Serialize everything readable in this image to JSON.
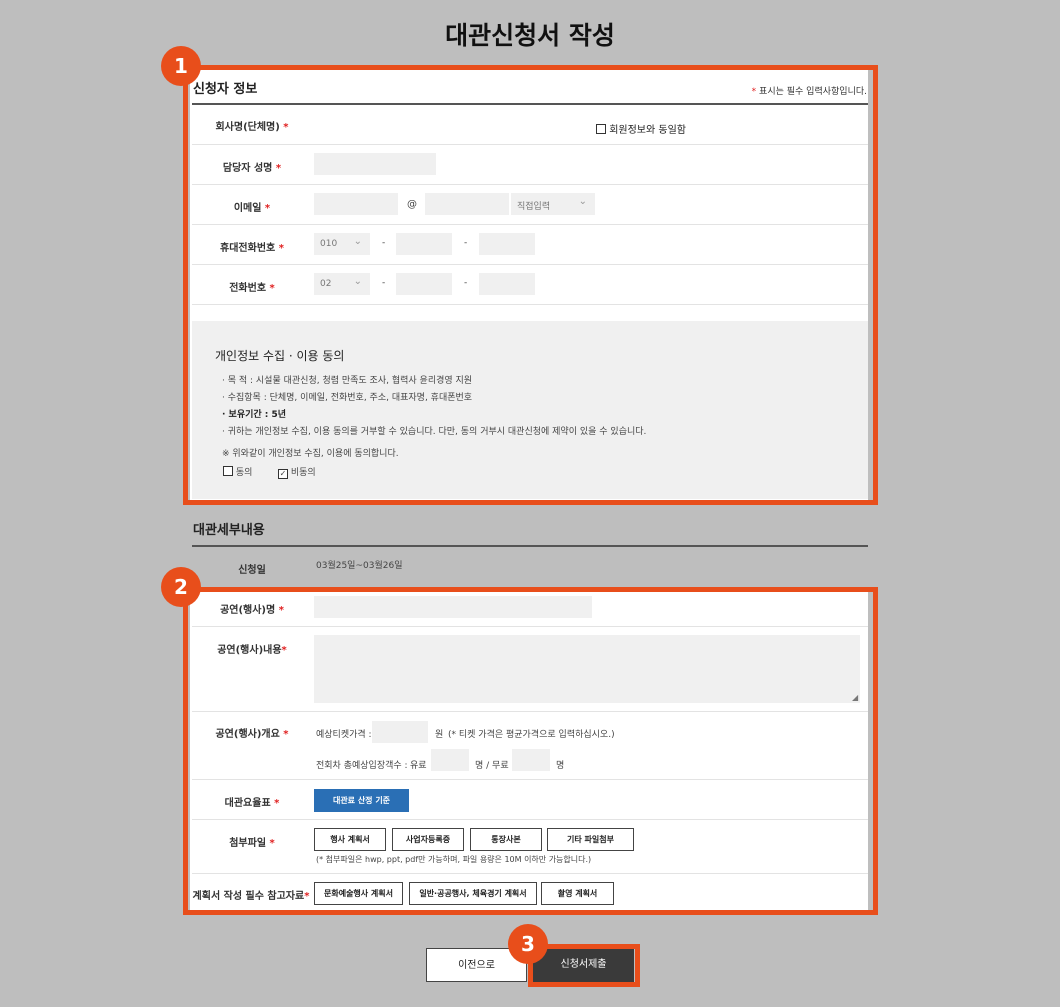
{
  "page": {
    "title": "대관신청서 작성"
  },
  "applicant": {
    "section_title": "신청자 정보",
    "required_note": "표시는 필수 입력사항입니다.",
    "required_star": "*",
    "company_label": "회사명(단체명)",
    "same_as_member": "회원정보와 동일함",
    "manager_label": "담당자 성명",
    "email_label": "이메일",
    "at_sign": "@",
    "email_domain_select": "직접입력",
    "mobile_label": "휴대전화번호",
    "mobile_prefix": "010",
    "phone_label": "전화번호",
    "phone_prefix": "02",
    "dash": "-"
  },
  "privacy": {
    "title": "개인정보 수집 · 이용 동의",
    "purpose": "· 목 적 : 시설물 대관신청, 청렴 만족도 조사, 협력사 윤리경영 지원",
    "items": "· 수집항목 : 단체명, 이메일, 전화번호, 주소, 대표자명, 휴대폰번호",
    "retention": "· 보유기간 : 5년",
    "refuse": "· 귀하는 개인정보 수집, 이용 동의를 거부할 수 있습니다. 다만, 동의 거부시 대관신청에 제약이 있을 수 있습니다.",
    "confirm": "※ 위와같이 개인정보 수집, 이용에 동의합니다.",
    "agree": "동의",
    "disagree": "비동의",
    "disagree_mark": "✓"
  },
  "details": {
    "section_title": "대관세부내용",
    "date_label": "신청일",
    "date_value": "03월25일~03월26일",
    "show_name_label": "공연(행사)명",
    "show_content_label": "공연(행사)내용",
    "overview_label": "공연(행사)개요",
    "ticket_price_label": "예상티켓가격 :",
    "won": "원",
    "ticket_note": "(* 티켓 가격은 평균가격으로 입력하십시오.)",
    "audience_label": "전회차 총예상입장객수 :",
    "paid": "유료",
    "free_sep": "명 / 무료",
    "persons": "명",
    "fee_label": "대관요율표",
    "fee_button": "대관료 산정 기준",
    "attach_label": "첨부파일",
    "attach_buttons": [
      "행사 계획서",
      "사업자등록증",
      "통장사본",
      "기타 파일첨부"
    ],
    "attach_note": "(* 첨부파일은 hwp, ppt, pdf만 가능하며, 파일 용량은 10M 이하만 가능합니다.)",
    "ref_label": "계획서 작성 필수 참고자료",
    "ref_buttons": [
      "문화예술행사 계획서",
      "일반·공공행사, 체육경기 계획서",
      "촬영 계획서"
    ]
  },
  "footer": {
    "prev": "이전으로",
    "submit": "신청서제출"
  },
  "callouts": [
    "1",
    "2",
    "3"
  ],
  "colors": {
    "highlight": "#e84e1b",
    "primary": "#2a6fb5",
    "submit_bg": "#3a3a3a",
    "background": "#bebebe"
  }
}
